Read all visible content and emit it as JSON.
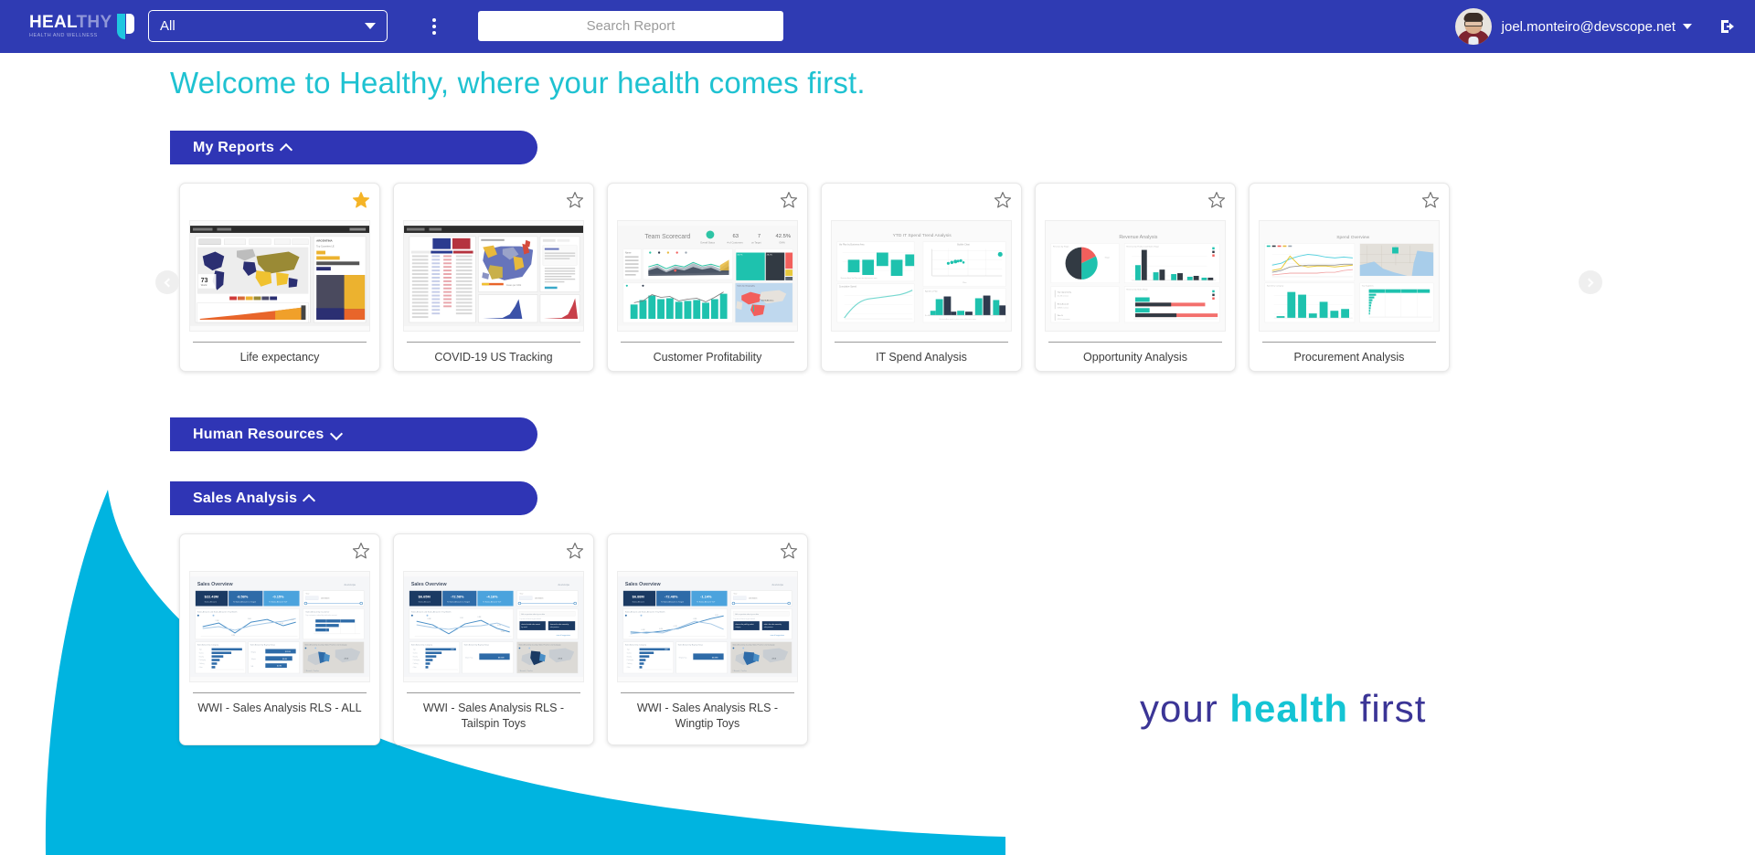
{
  "header": {
    "logo": {
      "main_a": "HEAL",
      "main_b": "THY",
      "sub": "HEALTH AND WELLNESS"
    },
    "filter": {
      "value": "All",
      "options": [
        "All"
      ]
    },
    "kebab_label": "more-options",
    "search": {
      "value": "",
      "placeholder": "Search Report"
    },
    "user": {
      "email": "joel.monteiro@devscope.net"
    }
  },
  "welcome": "Welcome to Healthy, where your health comes first.",
  "sections": [
    {
      "id": "my-reports",
      "title": "My Reports",
      "expanded": true,
      "chevron": "chevron-up"
    },
    {
      "id": "human-resources",
      "title": "Human Resources",
      "expanded": false,
      "chevron": "chevron-down"
    },
    {
      "id": "sales-analysis",
      "title": "Sales Analysis",
      "expanded": true,
      "chevron": "chevron-up"
    }
  ],
  "my_reports": [
    {
      "title": "Life expectancy",
      "favorite": true
    },
    {
      "title": "COVID-19 US Tracking",
      "favorite": false
    },
    {
      "title": "Customer Profitability",
      "favorite": false
    },
    {
      "title": "IT Spend Analysis",
      "favorite": false
    },
    {
      "title": "Opportunity Analysis",
      "favorite": false
    },
    {
      "title": "Procurement Analysis",
      "favorite": false
    }
  ],
  "sales_analysis": [
    {
      "title": "WWI - Sales Analysis RLS - ALL",
      "favorite": false
    },
    {
      "title": "WWI - Sales Analysis RLS - Tailspin Toys",
      "favorite": false
    },
    {
      "title": "WWI - Sales Analysis RLS - Wingtip Toys",
      "favorite": false
    }
  ],
  "thumbnail_titles": {
    "customer_profitability": "Team Scorecard",
    "it_spend": "YTD IT Spend Trend Analysis",
    "opportunity": "Revenue Analysis",
    "procurement": "Spend Overview",
    "sales_overview": "Sales Overview"
  },
  "thumbnail_stats": {
    "life_expectancy_value": "73",
    "customer_profitability_kpis": [
      "63",
      "7",
      "42.5%"
    ]
  },
  "carousel": {
    "prev_label": "previous",
    "next_label": "next"
  },
  "brand_slogan": {
    "part1": "your",
    "part2": "health",
    "part3": "first"
  },
  "colors": {
    "header_blue": "#2f3bb3",
    "banner_blue": "#2f35b5",
    "accent_cyan": "#1fc2d1",
    "wave_cyan": "#00b4e0",
    "star_gold": "#f5b427",
    "slogan_purple": "#3b3596"
  }
}
